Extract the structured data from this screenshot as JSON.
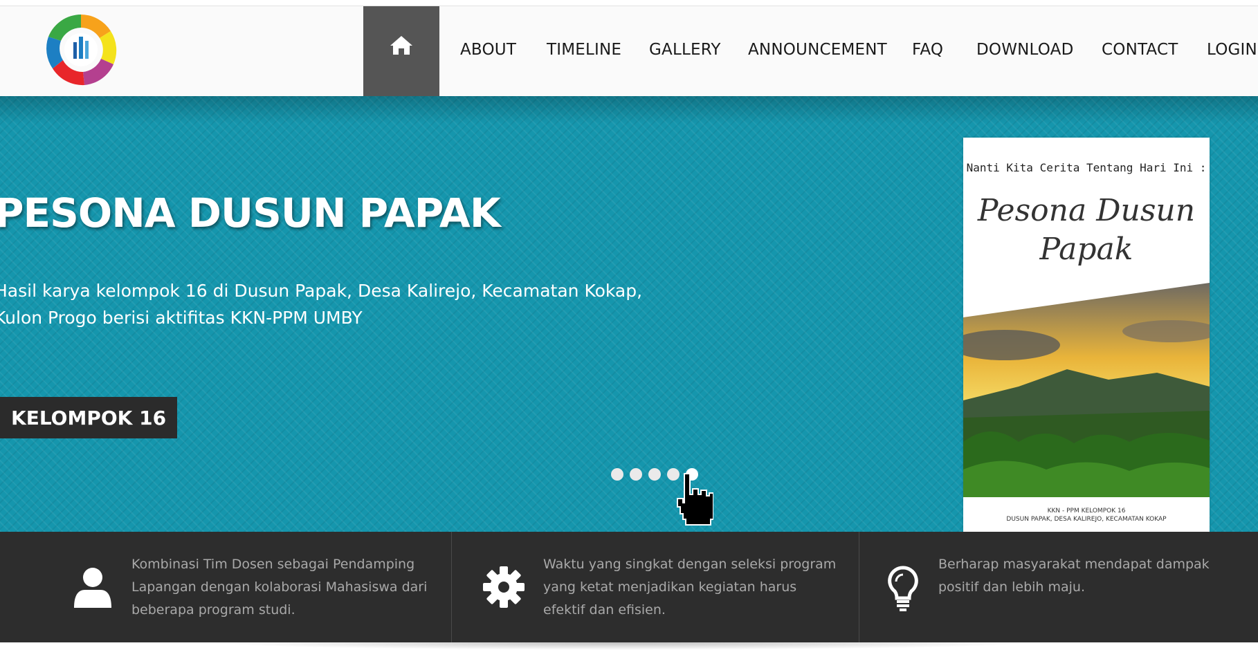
{
  "nav": {
    "home_icon": "home-icon",
    "items": [
      "ABOUT",
      "TIMELINE",
      "GALLERY",
      "ANNOUNCEMENT",
      "FAQ",
      "DOWNLOAD",
      "CONTACT",
      "LOGIN"
    ]
  },
  "hero": {
    "title": "PESONA DUSUN PAPAK",
    "description": "Hasil karya kelompok 16 di Dusun Papak, Desa Kalirejo, Kecamatan Kokap, Kulon Progo berisi aktifitas KKN-PPM UMBY",
    "button_label": "KELOMPOK 16",
    "slide_count": 5,
    "active_slide": 5,
    "poster": {
      "heading": "Nanti Kita Cerita Tentang Hari Ini :",
      "script_title": "Pesona Dusun Papak",
      "caption_line1": "KKN - PPM KELOMPOK 16",
      "caption_line2": "DUSUN PAPAK, DESA KALIREJO, KECAMATAN KOKAP"
    }
  },
  "features": [
    {
      "icon": "user-icon",
      "text": "Kombinasi Tim Dosen sebagai Pendamping Lapangan dengan kolaborasi Mahasiswa dari beberapa program studi."
    },
    {
      "icon": "gear-icon",
      "text": "Waktu yang singkat dengan seleksi program yang ketat menjadikan kegiatan harus efektif dan efisien."
    },
    {
      "icon": "lightbulb-icon",
      "text": "Berharap masyarakat mendapat dampak positif dan lebih maju."
    }
  ],
  "colors": {
    "hero_bg": "#1596ad",
    "nav_active": "#555555",
    "features_bg": "#2d2d2d"
  }
}
